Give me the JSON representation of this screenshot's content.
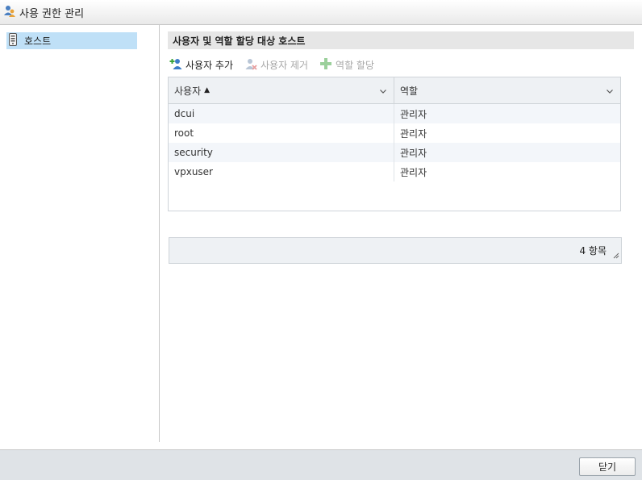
{
  "window": {
    "title": "사용 권한 관리",
    "icon": "users-permission-icon"
  },
  "sidebar": {
    "items": [
      {
        "label": "호스트",
        "icon": "host-device-icon",
        "selected": true
      }
    ]
  },
  "main": {
    "header": "사용자 및 역할 할당 대상 호스트",
    "toolbar": {
      "add_user": {
        "label": "사용자 추가",
        "icon": "add-user-icon",
        "enabled": true
      },
      "remove_user": {
        "label": "사용자 제거",
        "icon": "remove-user-icon",
        "enabled": false
      },
      "assign_role": {
        "label": "역할 할당",
        "icon": "plus-icon",
        "enabled": false
      }
    },
    "table": {
      "columns": [
        {
          "label": "사용자",
          "sort": "▲"
        },
        {
          "label": "역할"
        }
      ],
      "rows": [
        {
          "user": "dcui",
          "role": "관리자"
        },
        {
          "user": "root",
          "role": "관리자"
        },
        {
          "user": "security",
          "role": "관리자"
        },
        {
          "user": "vpxuser",
          "role": "관리자"
        }
      ],
      "footer_count": "4 항목"
    }
  },
  "footer": {
    "close_label": "닫기"
  },
  "colors": {
    "selection": "#bfe0f7",
    "header_bg": "#e6e6e6",
    "grid_header_bg": "#eef1f4",
    "accent_green": "#5cb85c"
  }
}
